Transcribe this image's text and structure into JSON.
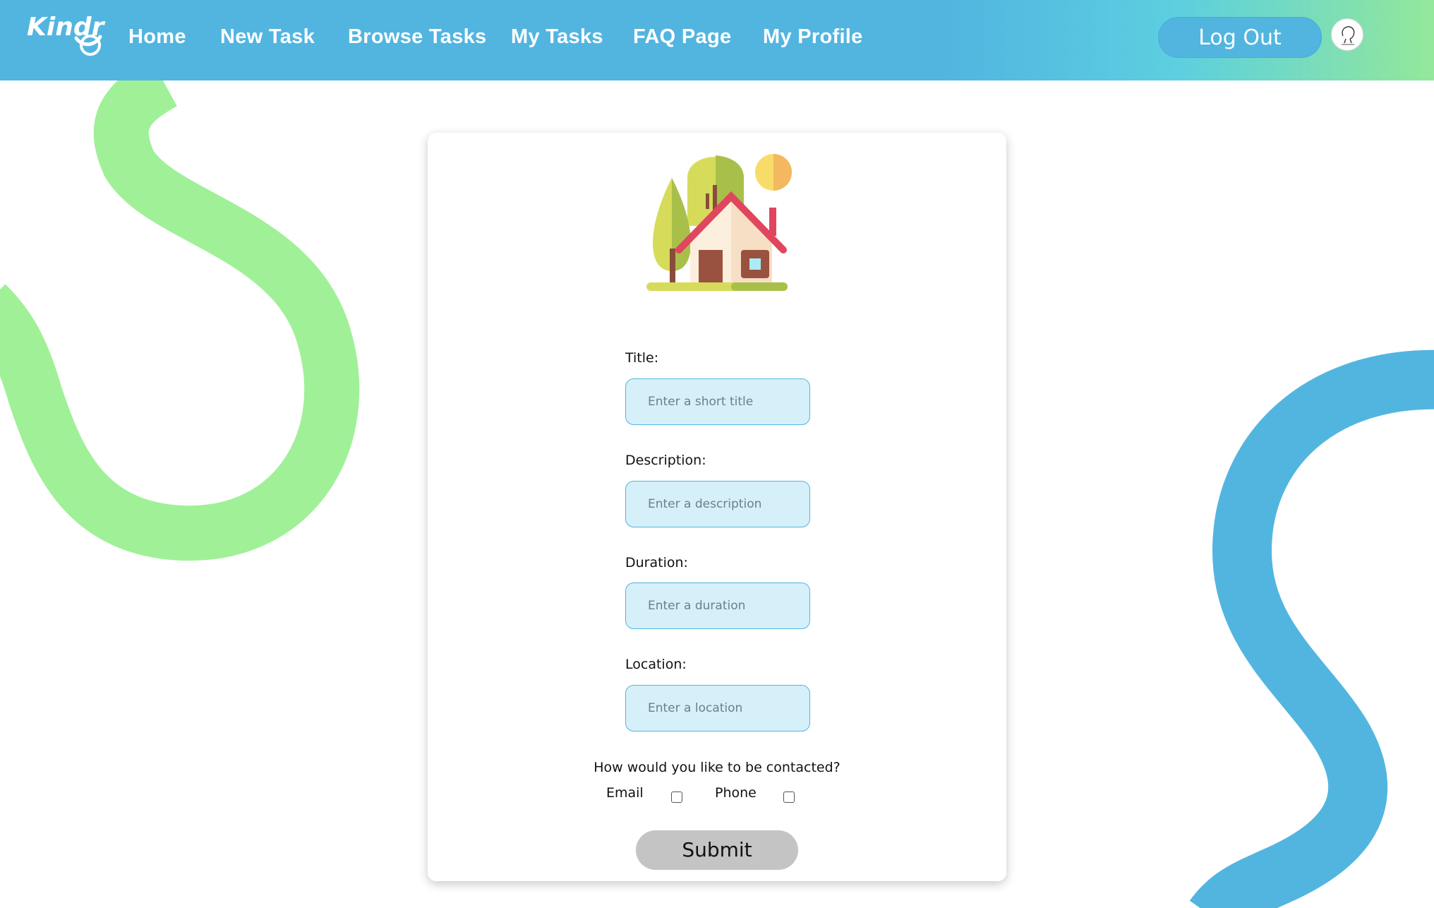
{
  "nav": {
    "logo_text": "Kindr",
    "links": [
      "Home",
      "New Task",
      "Browse Tasks",
      "My Tasks",
      "FAQ Page",
      "My Profile"
    ],
    "logout_label": "Log Out"
  },
  "colors": {
    "nav_blue": "#52b5e0",
    "nav_green": "#93e89a",
    "swirl_green": "#a0f098",
    "swirl_blue": "#52b5e0",
    "input_bg": "#d6f0f9",
    "submit_bg": "#c4c4c4"
  },
  "form": {
    "illustration": "house-with-trees-and-sun",
    "fields": [
      {
        "label": "Title:",
        "placeholder": "Enter a short title"
      },
      {
        "label": "Description:",
        "placeholder": "Enter a description"
      },
      {
        "label": "Duration:",
        "placeholder": "Enter a duration"
      },
      {
        "label": "Location:",
        "placeholder": "Enter a location"
      }
    ],
    "contact_question": "How would you like to be contacted?",
    "contact_options": [
      "Email",
      "Phone"
    ],
    "submit_label": "Submit"
  }
}
